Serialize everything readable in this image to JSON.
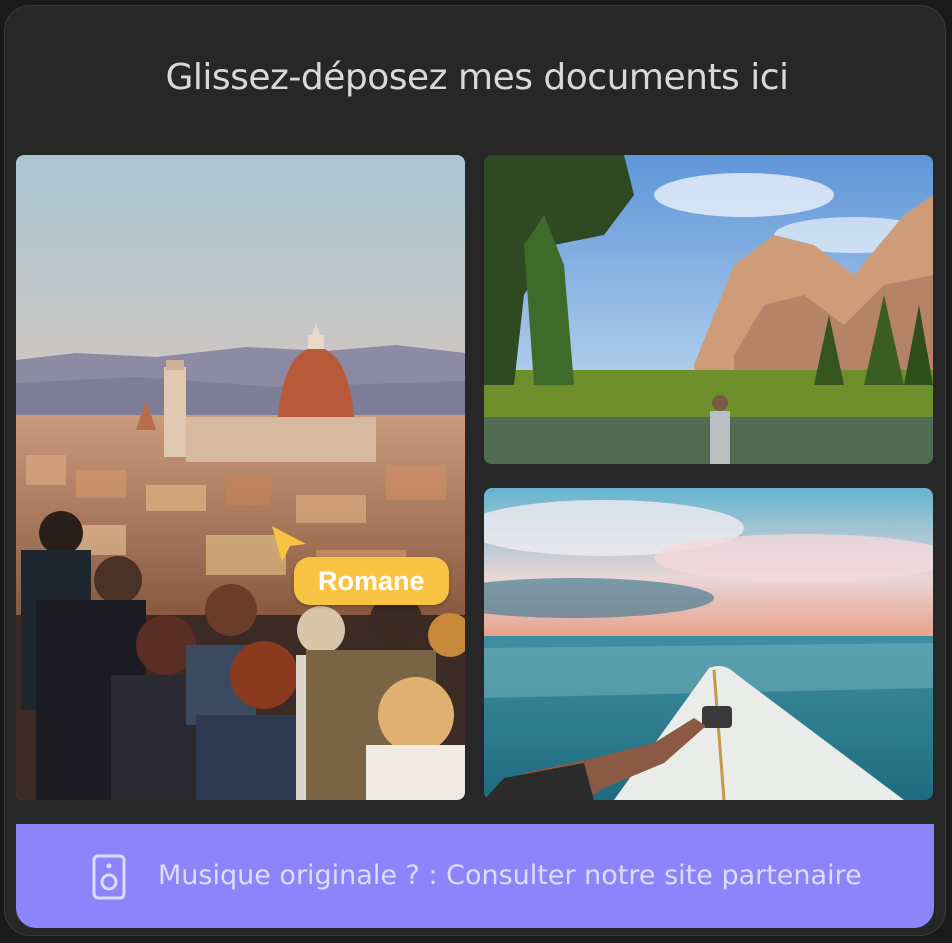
{
  "header": {
    "title": "Glissez-déposez mes documents ici"
  },
  "gallery": {
    "images": [
      {
        "name": "florence-cathedral-photo",
        "description_icon": "photo"
      },
      {
        "name": "yosemite-mountain-photo",
        "description_icon": "photo"
      },
      {
        "name": "surfboard-ocean-photo",
        "description_icon": "photo"
      }
    ]
  },
  "cursor": {
    "user": "Romane",
    "color": "#f8c343"
  },
  "banner": {
    "text": "Musique originale ? : Consulter notre site partenaire",
    "icon": "speaker-icon",
    "color": "#8b84fb"
  },
  "colors": {
    "panel": "#272727",
    "title_text": "#d9d9d9",
    "banner_text": "#dedcff"
  }
}
